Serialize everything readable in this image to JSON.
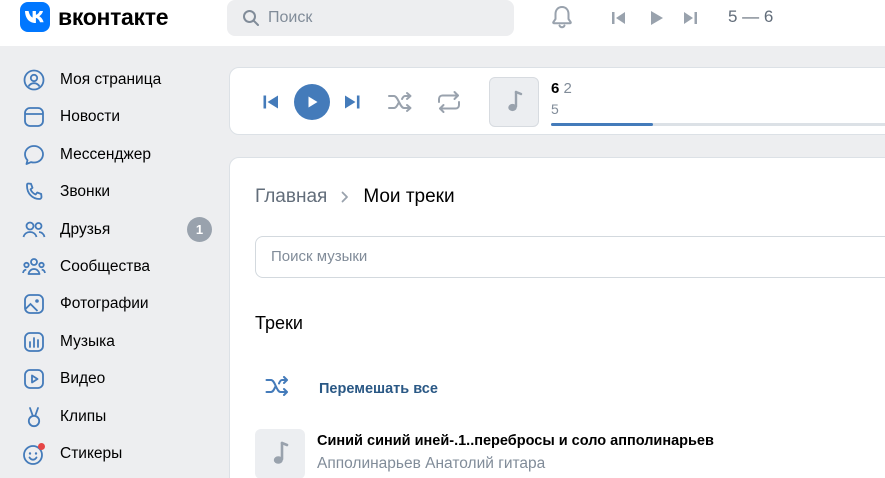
{
  "header": {
    "logo_text": "вконтакте",
    "search_placeholder": "Поиск",
    "now_playing": "5 — 6"
  },
  "sidebar": {
    "items": [
      {
        "label": "Моя страница",
        "icon": "user-circle-icon"
      },
      {
        "label": "Новости",
        "icon": "news-icon"
      },
      {
        "label": "Мессенджер",
        "icon": "message-icon"
      },
      {
        "label": "Звонки",
        "icon": "phone-icon"
      },
      {
        "label": "Друзья",
        "icon": "friends-icon",
        "badge": "1"
      },
      {
        "label": "Сообщества",
        "icon": "communities-icon"
      },
      {
        "label": "Фотографии",
        "icon": "photo-icon"
      },
      {
        "label": "Музыка",
        "icon": "music-icon"
      },
      {
        "label": "Видео",
        "icon": "video-icon"
      },
      {
        "label": "Клипы",
        "icon": "clips-icon"
      },
      {
        "label": "Стикеры",
        "icon": "stickers-icon"
      }
    ]
  },
  "player": {
    "title": "6",
    "title_suffix": "2",
    "artist": "5",
    "progress": 0.3
  },
  "main": {
    "breadcrumb_home": "Главная",
    "breadcrumb_current": "Мои треки",
    "search_placeholder": "Поиск музыки",
    "section_title": "Треки",
    "shuffle_label": "Перемешать все",
    "track": {
      "title": "Синий синий иней-.1..переброс­ы и соло апполинарьев",
      "artist": "Апполинарьев Анатолий гитара"
    }
  },
  "colors": {
    "accent": "#447bba",
    "link": "#2a5885",
    "brand": "#0077ff",
    "notification_dot": "#e64646"
  }
}
